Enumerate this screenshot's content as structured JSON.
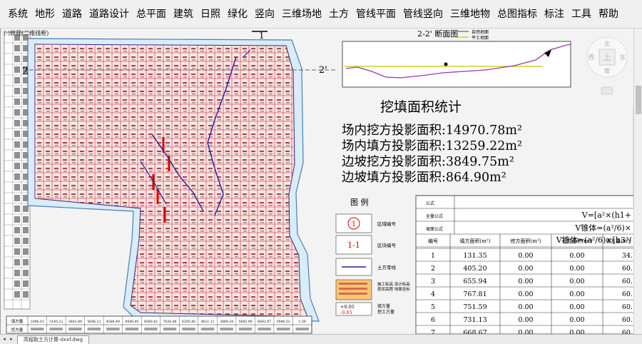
{
  "menu": [
    "系统",
    "地形",
    "道路",
    "道路设计",
    "总平面",
    "建筑",
    "日照",
    "绿化",
    "竖向",
    "三维场地",
    "土方",
    "管线平面",
    "管线竖向",
    "三维地物",
    "总图指标",
    "标注",
    "工具",
    "帮助"
  ],
  "doc_label": "(-)俯视(二维线框)",
  "section": {
    "marker_left": "2",
    "marker_right": "2'",
    "top_marker": "1",
    "title": "2-2' 断面图",
    "legend": [
      "自然地面",
      "平土地面"
    ],
    "colors": {
      "natural": "#9b3aa8",
      "design": "#c8c800"
    }
  },
  "stats": {
    "title": "挖填面积统计",
    "lines": [
      "场内挖方投影面积:14970.78m²",
      "场内填方投影面积:13259.22m²",
      "边坡挖方投影面积:3849.75m²",
      "边坡填方投影面积:864.90m²"
    ]
  },
  "legend": {
    "title": "图 例",
    "items": [
      {
        "sym": "1",
        "label": "区域编号"
      },
      {
        "sym": "1-1",
        "label": "区块编号"
      },
      {
        "sym": "",
        "label": "土方零线"
      },
      {
        "sym": "",
        "label": "施工标高 设计标高 现状高程 地面坐标"
      },
      {
        "sym": "+0.05 -0.65",
        "label": "填方量 挖土方量"
      }
    ]
  },
  "table": {
    "formula_label": "公式",
    "full_label": "全量公式",
    "slope_label": "坡面公式",
    "formula1": "V=[a²×(h1+",
    "formula2": "V锥体=(a²/6)×",
    "formula3": "V锥体=(a²/6)×[h3³/",
    "headers": [
      "编号",
      "填方面积(m²)",
      "挖方面积(m²)",
      "石方面积(m²)",
      "填方量(m³)"
    ],
    "rows": [
      [
        "1",
        "131.35",
        "0.00",
        "0.00",
        "34."
      ],
      [
        "2",
        "405.20",
        "0.00",
        "0.00",
        "60."
      ],
      [
        "3",
        "655.94",
        "0.00",
        "0.00",
        "60."
      ],
      [
        "4",
        "767.81",
        "0.00",
        "0.00",
        "60."
      ],
      [
        "5",
        "751.59",
        "0.00",
        "0.00",
        "60."
      ],
      [
        "6",
        "731.13",
        "0.00",
        "0.00",
        "60."
      ],
      [
        "7",
        "668.67",
        "0.00",
        "0.00",
        "60."
      ]
    ]
  },
  "bottom_table": {
    "row1_label": "填方量",
    "row2_label": "挖方量",
    "values": [
      "2096.03",
      "5145.12",
      "5601.89",
      "5646.12",
      "4580.49",
      "4580.05",
      "4580.42",
      "7026.48",
      "6205.40",
      "4621.11",
      "3869.24",
      "5065.98",
      "6642.87",
      "5946.53",
      "1.58"
    ]
  },
  "compass": {
    "north": "北",
    "south": "南",
    "east": "东",
    "west": "西",
    "center": "上"
  },
  "tab_label": "高程取土方计算-dxxf.dwg"
}
